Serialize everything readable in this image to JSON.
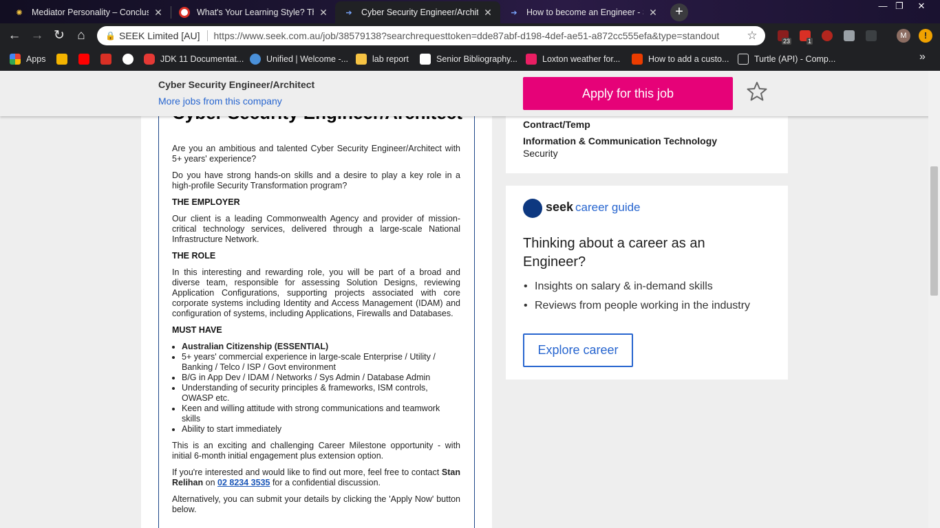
{
  "browser": {
    "tabs": [
      {
        "title": "Mediator Personality – Conclusio",
        "icon": "atom-icon"
      },
      {
        "title": "What's Your Learning Style? The",
        "icon": "target-icon"
      },
      {
        "title": "Cyber Security Engineer/Architec",
        "icon": "seek-arrow-icon"
      },
      {
        "title": "How to become an Engineer - Se",
        "icon": "seek-arrow-icon"
      }
    ],
    "active_tab": 2,
    "new_tab": "+",
    "window_controls": {
      "minimize": "—",
      "restore": "❐",
      "close": "✕"
    },
    "nav": {
      "back": "←",
      "forward": "→",
      "reload": "↻",
      "home": "⌂"
    },
    "address": {
      "org": "SEEK Limited [AU]",
      "url": "https://www.seek.com.au/job/38579138?searchrequesttoken=dde87abf-d198-4def-ae51-a872cc555efa&type=standout"
    },
    "extension_badges": [
      "23",
      "1"
    ],
    "profile_initial": "M",
    "update_icon": "!",
    "bookmarks": [
      {
        "label": "Apps",
        "color": "#e94235"
      },
      {
        "label": "",
        "color": "#f4b400"
      },
      {
        "label": "",
        "color": "#ff0000"
      },
      {
        "label": "",
        "color": "#d93025"
      },
      {
        "label": "",
        "color": "#ffffff"
      },
      {
        "label": "JDK 11 Documentat...",
        "color": "#e53935"
      },
      {
        "label": "Unified | Welcome -...",
        "color": "#4a90d9"
      },
      {
        "label": "lab report",
        "color": "#f6c343"
      },
      {
        "label": "Senior Bibliography...",
        "color": "#ffffff"
      },
      {
        "label": "Loxton weather for...",
        "color": "#e91e63"
      },
      {
        "label": "How to add a custo...",
        "color": "#eb3c00"
      },
      {
        "label": "Turtle (API) - Comp...",
        "color": "#dddddd"
      }
    ],
    "bookmarks_more": "»"
  },
  "sticky": {
    "job_title": "Cyber Security Engineer/Architect",
    "company_link": "More jobs from this company",
    "apply_label": "Apply for this job"
  },
  "ad": {
    "heading": "Cyber Security Engineer/Architect",
    "p1": "Are you an ambitious and talented Cyber Security Engineer/Architect with 5+ years' experience?",
    "p2": "Do you have strong hands-on skills and a desire to play a key role in a high-profile Security Transformation program?",
    "h_employer": "THE EMPLOYER",
    "p_employer": "Our client is a leading Commonwealth Agency and provider of mission-critical technology services, delivered through a large-scale National Infrastructure Network.",
    "h_role": "THE ROLE",
    "p_role": "In this interesting and rewarding role, you will be part of a broad and diverse team, responsible for assessing Solution Designs, reviewing Application Configurations, supporting projects associated with core corporate systems including Identity and Access Management (IDAM) and configuration of systems, including Applications, Firewalls and Databases.",
    "h_must": "MUST HAVE",
    "must_have": [
      "Australian Citizenship (ESSENTIAL)",
      "5+ years' commercial experience in large-scale Enterprise / Utility / Banking / Telco / ISP / Govt environment",
      "B/G in App Dev / IDAM / Networks / Sys Admin / Database Admin",
      "Understanding of security principles & frameworks, ISM controls, OWASP etc.",
      "Keen and willing attitude with strong communications and teamwork skills",
      "Ability to start immediately"
    ],
    "p_milestone": "This is an exciting and challenging Career Milestone opportunity - with initial 6-month initial engagement plus extension option.",
    "contact_pre": "If you're interested and would like to find out more, feel free to contact ",
    "contact_name": "Stan Relihan",
    "contact_on": " on ",
    "contact_phone": "02 8234 3535",
    "contact_post": " for a confidential discussion.",
    "p_alt": "Alternatively, you can submit your details by clicking the 'Apply Now' button below."
  },
  "details": {
    "work_type": "Contract/Temp",
    "classification": "Information & Communication Technology",
    "subclass": "Security"
  },
  "career_guide": {
    "brand": "seek",
    "brand_suffix": "career guide",
    "heading": "Thinking about a career as an Engineer?",
    "bullets": [
      "Insights on salary & in-demand skills",
      "Reviews from people working in the industry"
    ],
    "button": "Explore career"
  },
  "colors": {
    "apply": "#e60278",
    "link": "#2765cf",
    "ad_border": "#1c4587"
  }
}
